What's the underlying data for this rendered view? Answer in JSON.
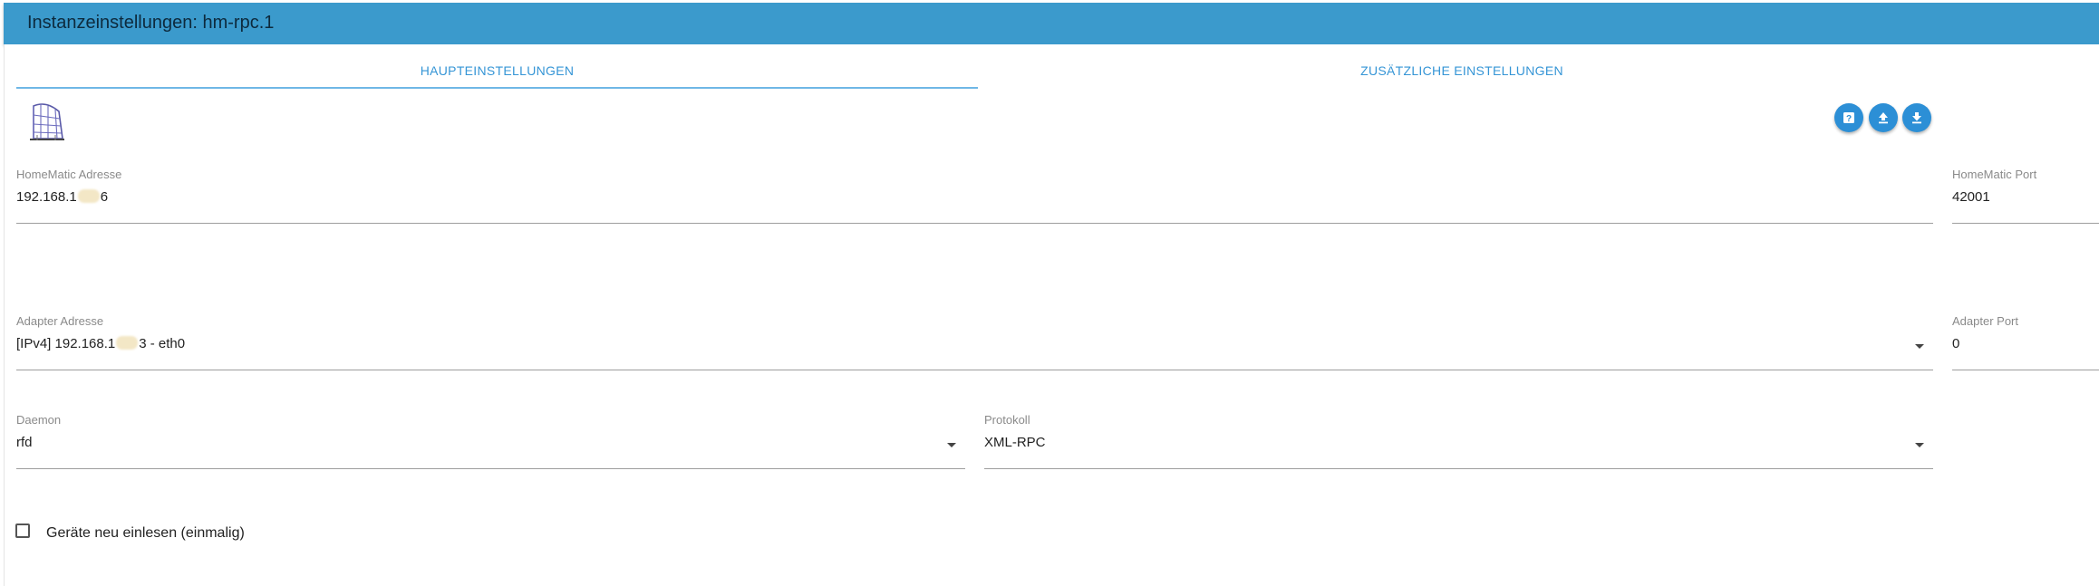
{
  "window": {
    "title": "Instanzeinstellungen: hm-rpc.1"
  },
  "tabs": [
    {
      "label": "HAUPTEINSTELLUNGEN",
      "active": true
    },
    {
      "label": "ZUSÄTZLICHE EINSTELLUNGEN",
      "active": false
    }
  ],
  "toolbar": {
    "icons": [
      "help-icon",
      "upload-icon",
      "download-icon"
    ]
  },
  "colors": {
    "accent": "#3b9acc",
    "button": "#2c8fd6",
    "tab_text": "#3595d6"
  },
  "fields": {
    "homematic_address": {
      "label": "HomeMatic Adresse",
      "value_prefix": "192.168.1",
      "value_suffix": "6"
    },
    "homematic_port": {
      "label": "HomeMatic Port",
      "value": "42001"
    },
    "adapter_address": {
      "label": "Adapter Adresse",
      "value_prefix": "[IPv4] 192.168.1",
      "value_suffix": "3 - eth0"
    },
    "adapter_port": {
      "label": "Adapter Port",
      "value": "0"
    },
    "daemon": {
      "label": "Daemon",
      "value": "rfd"
    },
    "protocol": {
      "label": "Protokoll",
      "value": "XML-RPC"
    }
  },
  "checkbox": {
    "label": "Geräte neu einlesen (einmalig)",
    "checked": false
  }
}
